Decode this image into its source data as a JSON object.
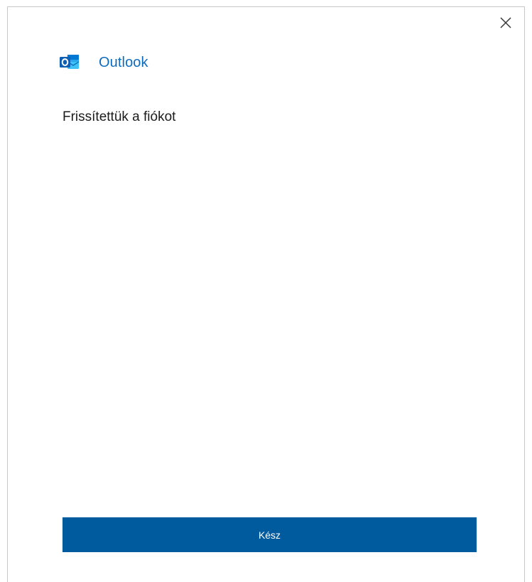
{
  "dialog": {
    "close_icon": "close-icon",
    "brand": {
      "logo_icon": "outlook-logo-icon",
      "name": "Outlook",
      "accent_color": "#0f6cbd"
    },
    "message": "Frissítettük a fiókot",
    "done_button": {
      "label": "Kész",
      "color": "#005a9e"
    }
  }
}
